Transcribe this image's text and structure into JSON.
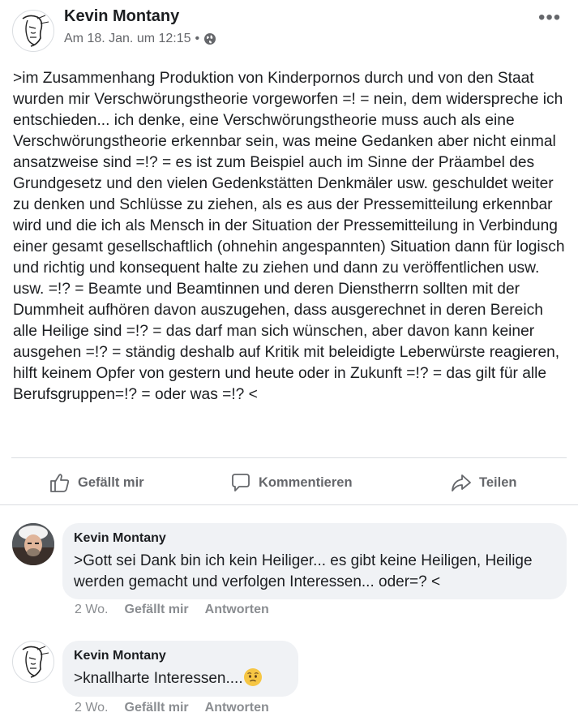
{
  "post": {
    "author": "Kevin Montany",
    "timestamp": "Am 18. Jan. um 12:15",
    "separator": "•",
    "privacy_icon": "globe-icon",
    "more_label": "•••",
    "text": ">im Zusammenhang Produktion von Kinderpornos durch und von den Staat wurden mir Verschwörungstheorie vorgeworfen =! = nein, dem widerspreche ich entschieden... ich denke, eine Verschwörungstheorie muss auch als eine Verschwörungstheorie erkennbar sein, was meine Gedanken aber nicht einmal ansatzweise sind =!? = es ist zum Beispiel auch im Sinne der Präambel des Grundgesetz und den vielen Gedenkstätten Denkmäler usw. geschuldet weiter zu denken und Schlüsse zu ziehen, als es aus der Pressemitteilung erkennbar wird und die ich als Mensch in der Situation der Pressemitteilung in Verbindung einer gesamt gesellschaftlich (ohnehin angespannten) Situation dann für logisch und richtig und konsequent halte zu ziehen und dann zu veröffentlichen usw. usw. =!? = Beamte und Beamtinnen und deren Diensthe­rrn sollten mit der Dummheit aufhören davon auszugehen, dass ausgerechnet in deren Bereich alle Heilige sind =!? = das darf man sich wünschen, aber davon kann keiner ausgehen =!? = ständig deshalb auf Kritik mit beleidigte Leberwürste reagieren, hilft keinem Opfer von gestern und heute oder in Zukunft =!? = das gilt für alle Berufsgruppen=!? = oder was =!? <"
  },
  "actions": {
    "like": "Gefällt mir",
    "comment": "Kommentieren",
    "share": "Teilen"
  },
  "comments": [
    {
      "author": "Kevin Montany",
      "text": ">Gott sei Dank bin ich kein Heiliger... es gibt keine Heiligen, Heilige werden gemacht und verfolgen Interessen... oder=? <",
      "time": "2 Wo.",
      "like": "Gefällt mir",
      "reply": "Antworten",
      "avatar": "photo-avatar"
    },
    {
      "author": "Kevin Montany",
      "text": ">knallharte Interessen....",
      "emoji": "worried-face-emoji",
      "time": "2 Wo.",
      "like": "Gefällt mir",
      "reply": "Antworten",
      "avatar": "sketch-avatar"
    }
  ],
  "colors": {
    "text": "#1c1e21",
    "secondary": "#65676b",
    "bubble": "#f0f2f5",
    "divider": "#dadde1"
  }
}
